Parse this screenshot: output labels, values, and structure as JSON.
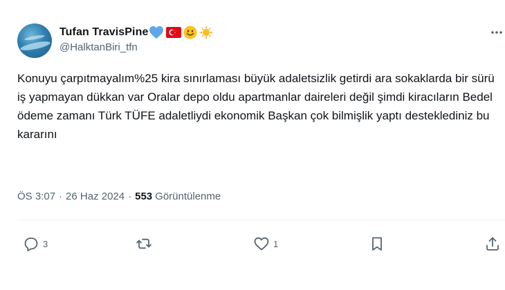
{
  "author": {
    "display_name": "Tufan TravisPine",
    "emoji": [
      "blue-heart-icon",
      "turkey-flag-icon",
      "smiling-face-icon",
      "sun-icon"
    ],
    "handle": "@HalktanBiri_tfn"
  },
  "tweet": {
    "text": "Konuyu çarpıtmayalım%25 kira sınırlaması büyük adaletsizlik getirdi ara sokaklarda bir sürü iş yapmayan dükkan var Oralar depo oldu apartmanlar daireleri değil şimdi kiracıların Bedel ödeme zamanı Türk TÜFE adaletliydi ekonomik Başkan çok bilmişlik yaptı desteklediniz bu kararını"
  },
  "meta": {
    "time": "ÖS 3:07",
    "separator": "·",
    "date": "26 Haz 2024",
    "views_count": "553",
    "views_label": "Görüntülenme"
  },
  "actions": {
    "reply_count": "3",
    "retweet_count": "",
    "like_count": "1"
  },
  "colors": {
    "text": "#0f1419",
    "secondary": "#536471",
    "divider": "#eff3f4",
    "heart": "#5ea8e8",
    "flag_red": "#e30a17"
  }
}
